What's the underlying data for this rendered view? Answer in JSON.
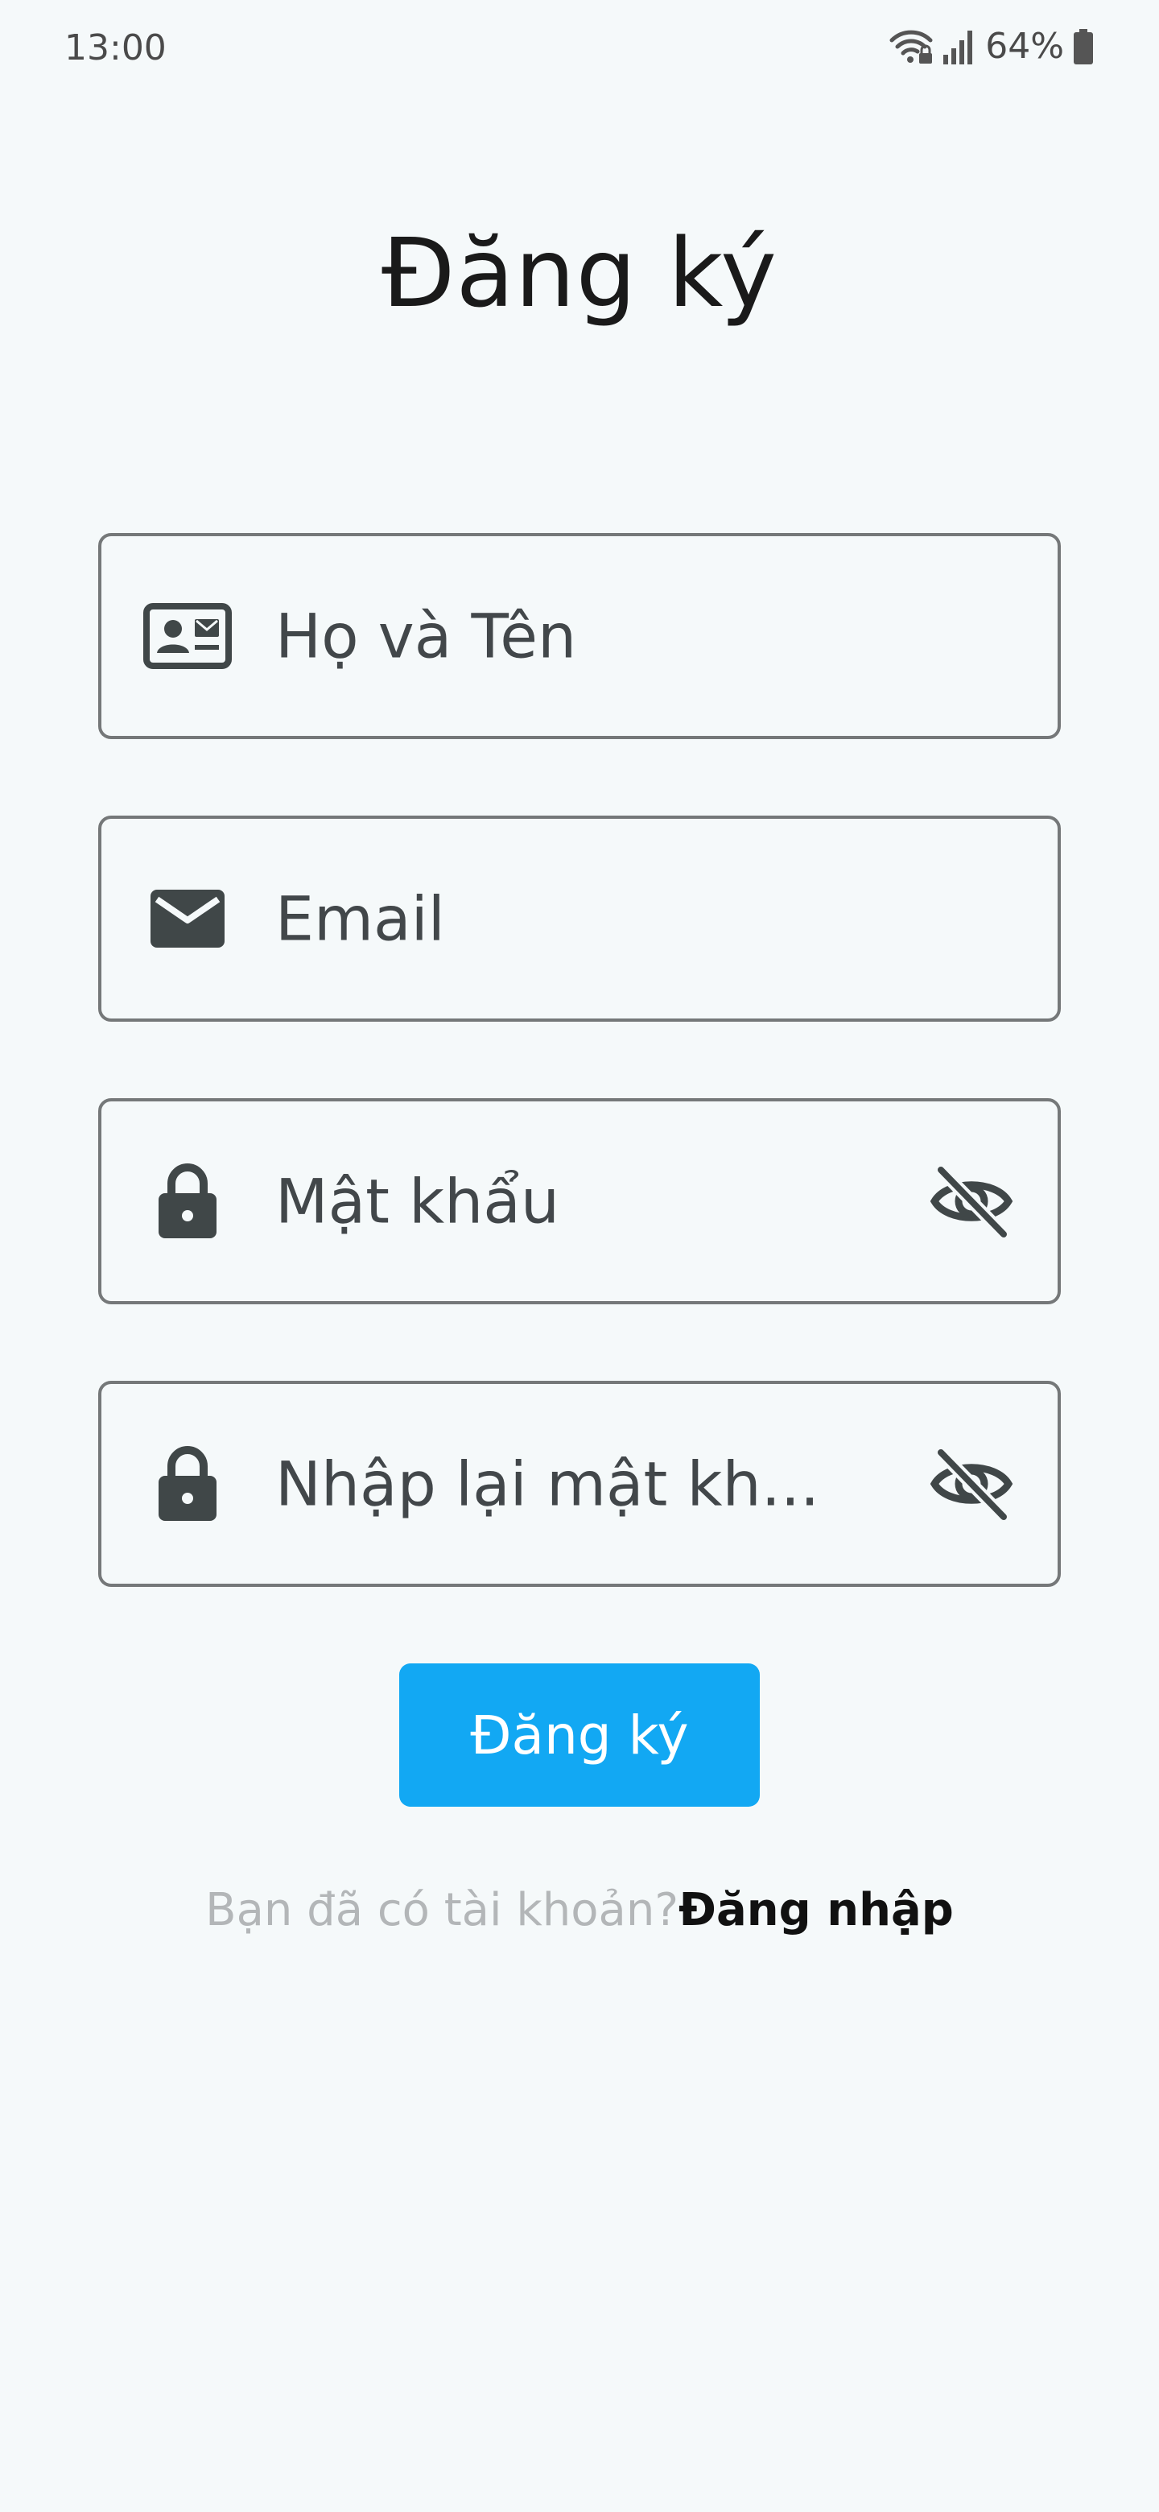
{
  "status_bar": {
    "time": "13:00",
    "battery": "64%",
    "icons": [
      "wifi-lock-icon",
      "signal-icon",
      "battery-icon"
    ]
  },
  "title": "Đăng ký",
  "form": {
    "name_placeholder": "Họ và Tên",
    "email_placeholder": "Email",
    "password_placeholder": "Mật khẩu",
    "confirm_placeholder": "Nhập lại mật kh...",
    "icons": {
      "name": "contact-card-icon",
      "email": "mail-icon",
      "password": "lock-icon",
      "confirm": "lock-icon",
      "visibility": "visibility-off-icon"
    }
  },
  "submit_label": "Đăng ký",
  "login_prompt": {
    "question": "Bạn đã có tài khoản?",
    "link": "Đăng nhập"
  },
  "colors": {
    "background": "#f5f9fa",
    "primary": "#12a8f3",
    "field_border": "#757879",
    "icon": "#404748",
    "muted_text": "#b3b6b8"
  }
}
